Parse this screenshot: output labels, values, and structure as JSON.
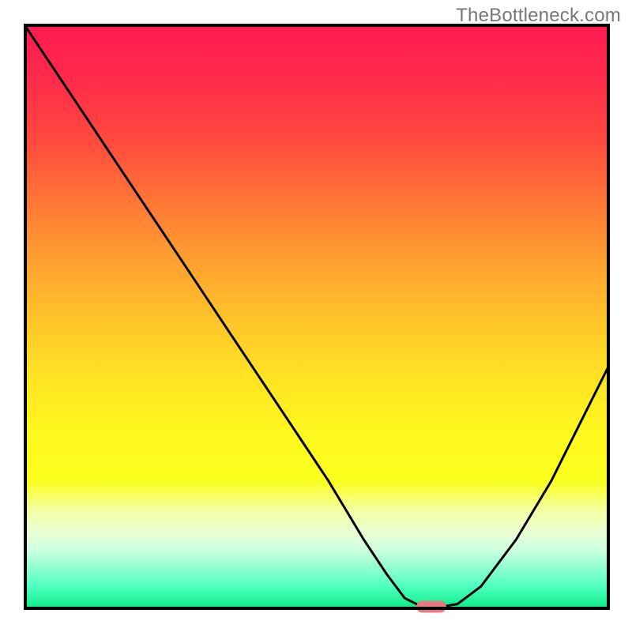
{
  "watermark": "TheBottleneck.com",
  "colors": {
    "curve_stroke": "#000000",
    "marker_fill": "#e77a7d",
    "border": "#000000",
    "gradient_top": "#ff1a52",
    "gradient_bottom": "#06ed80"
  },
  "chart_data": {
    "type": "line",
    "title": "",
    "xlabel": "",
    "ylabel": "",
    "xlim": [
      0,
      100
    ],
    "ylim": [
      0,
      100
    ],
    "x": [
      0,
      8,
      16,
      24,
      28,
      36,
      44,
      52,
      58,
      62,
      65,
      68,
      71,
      74,
      78,
      84,
      90,
      96,
      100
    ],
    "values": [
      100,
      88,
      76,
      64,
      58,
      46,
      34,
      22,
      12,
      6,
      2,
      0.5,
      0.5,
      1,
      4,
      12,
      22,
      34,
      42
    ],
    "marker": {
      "x": 69.5,
      "y": 0.5
    },
    "note": "Characteristic V-shaped bottleneck curve on a red-to-green vertical heat gradient."
  }
}
